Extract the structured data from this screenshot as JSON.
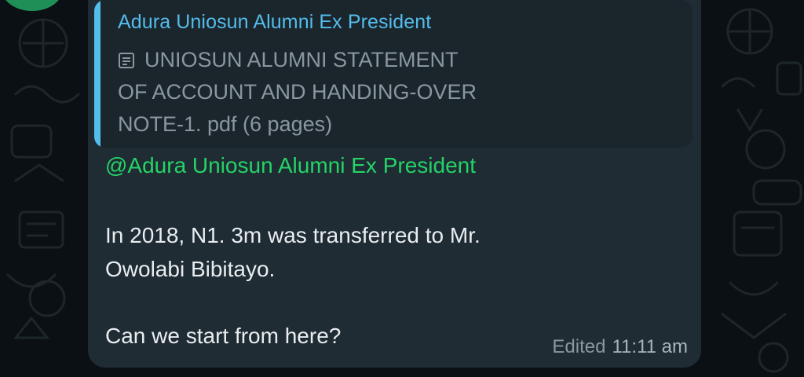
{
  "quoted_message": {
    "author": "Adura Uniosun Alumni  Ex President",
    "document_icon": "document-icon",
    "document_lines": [
      "UNIOSUN ALUMNI STATEMENT",
      "OF ACCOUNT AND HANDING-OVER",
      "NOTE-1. pdf (6 pages)"
    ]
  },
  "message": {
    "mention": "@Adura Uniosun Alumni  Ex President",
    "lines": [
      "In 2018,  N1. 3m was transferred to Mr.",
      "Owolabi Bibitayo.",
      "Can we start from here?"
    ],
    "edited_label": "Edited",
    "time": "11:11 am"
  },
  "colors": {
    "quote_accent": "#53bdeb",
    "mention": "#25d366",
    "bubble": "#1f2c34",
    "background": "#0b1014"
  }
}
